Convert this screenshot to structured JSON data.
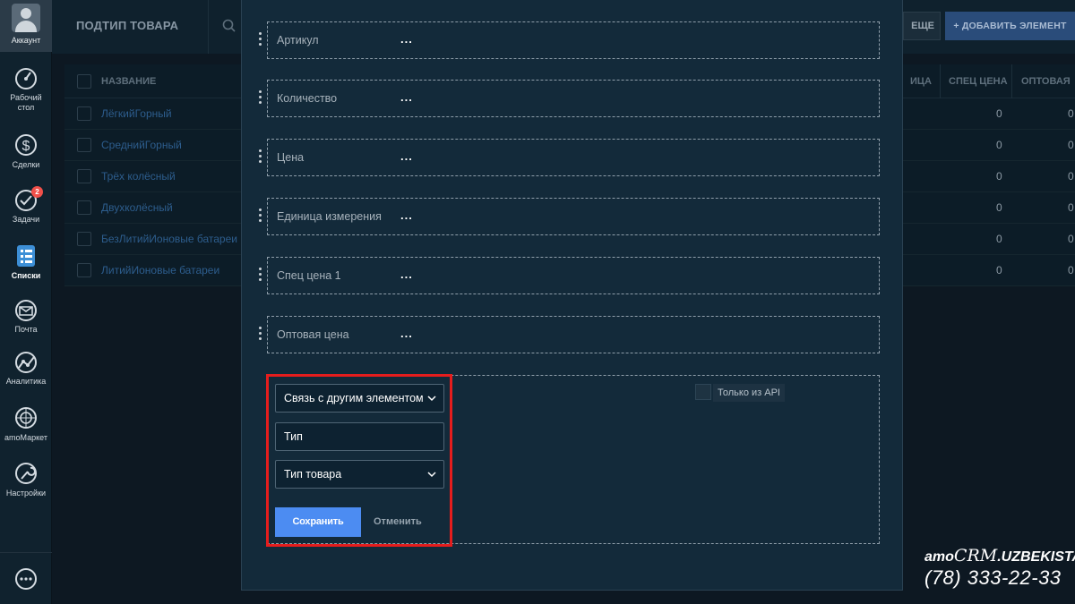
{
  "sidebar": {
    "account_label": "Аккаунт",
    "items": [
      {
        "label": "Рабочий",
        "label2": "стол",
        "icon": "dashboard-icon"
      },
      {
        "label": "Сделки",
        "icon": "dollar-icon"
      },
      {
        "label": "Задачи",
        "icon": "tasks-check-icon",
        "badge": "2"
      },
      {
        "label": "Списки",
        "icon": "lists-icon"
      },
      {
        "label": "Почта",
        "icon": "mail-icon"
      },
      {
        "label": "Аналитика",
        "icon": "analytics-icon"
      },
      {
        "label": "amoМаркет",
        "icon": "market-icon"
      },
      {
        "label": "Настройки",
        "icon": "wrench-icon"
      }
    ],
    "chat_icon": "chat-bubble-icon"
  },
  "page": {
    "title": "ПОДТИП ТОВАРА",
    "more_label": "ЕЩЕ",
    "add_label": "+ ДОБАВИТЬ ЭЛЕМЕНТ"
  },
  "table": {
    "columns": {
      "name": "НАЗВАНИЕ",
      "c1": "ИЦА",
      "c2": "СПЕЦ ЦЕНА",
      "c3": "ОПТОВАЯ"
    },
    "rows": [
      {
        "name": "ЛёгкийГорный",
        "v1": "0",
        "v2": "0"
      },
      {
        "name": "СреднийГорный",
        "v1": "0",
        "v2": "0"
      },
      {
        "name": "Трёх колёсный",
        "v1": "0",
        "v2": "0"
      },
      {
        "name": "Двухколёсный",
        "v1": "0",
        "v2": "0"
      },
      {
        "name": "БезЛитийИоновые батареи",
        "v1": "0",
        "v2": "0"
      },
      {
        "name": "ЛитийИоновые батареи",
        "v1": "0",
        "v2": "0"
      }
    ]
  },
  "modal": {
    "fields": [
      {
        "name": "Артикул",
        "value": "..."
      },
      {
        "name": "Количество",
        "value": "..."
      },
      {
        "name": "Цена",
        "value": "..."
      },
      {
        "name": "Единица измерения",
        "value": "..."
      },
      {
        "name": "Спец цена 1",
        "value": "..."
      },
      {
        "name": "Оптовая цена",
        "value": "..."
      }
    ],
    "new_field": {
      "type_select": "Связь с другим элементом",
      "name_input": "Тип",
      "link_select": "Тип товара",
      "api_only_label": "Только из API",
      "save_label": "Сохранить",
      "cancel_label": "Отменить"
    }
  },
  "brand": {
    "line1_a": "amo",
    "line1_b": "CRM",
    "line1_c": ".UZBEKISTAN",
    "phone": "(78) 333-22-33"
  },
  "colors": {
    "accent_blue": "#4c8cf2",
    "highlight_red": "#e51d1d",
    "modal_bg": "#132a3a",
    "badge_red": "#f0504a"
  }
}
